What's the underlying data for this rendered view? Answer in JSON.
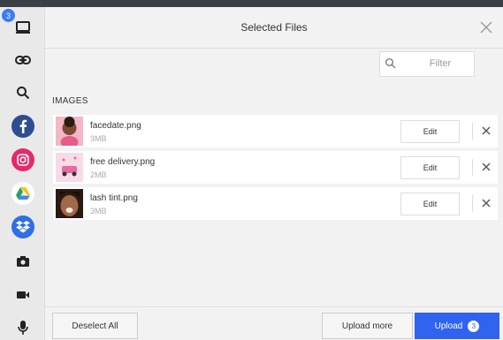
{
  "sidebar": {
    "local_badge": "3",
    "items": [
      {
        "name": "my-device",
        "icon": "monitor-icon"
      },
      {
        "name": "link",
        "icon": "link-icon"
      },
      {
        "name": "search",
        "icon": "search-icon"
      },
      {
        "name": "facebook",
        "icon": "facebook-icon",
        "color": "#2d4e8f"
      },
      {
        "name": "instagram",
        "icon": "instagram-icon",
        "color": "#e8286b"
      },
      {
        "name": "google-drive",
        "icon": "google-drive-icon",
        "color": "#ffffff"
      },
      {
        "name": "dropbox",
        "icon": "dropbox-icon",
        "color": "#2f6fe6"
      },
      {
        "name": "camera",
        "icon": "camera-icon"
      },
      {
        "name": "video",
        "icon": "video-icon"
      },
      {
        "name": "audio",
        "icon": "microphone-icon"
      }
    ]
  },
  "header": {
    "title": "Selected Files",
    "close_icon": "close-icon"
  },
  "filter": {
    "placeholder": "Filter",
    "icon": "search-icon"
  },
  "section_label": "IMAGES",
  "files": [
    {
      "name": "facedate.png",
      "size": "3MB",
      "edit_label": "Edit"
    },
    {
      "name": "free delivery.png",
      "size": "2MB",
      "edit_label": "Edit"
    },
    {
      "name": "lash tint.png",
      "size": "3MB",
      "edit_label": "Edit"
    }
  ],
  "footer": {
    "deselect_label": "Deselect All",
    "upload_more_label": "Upload more",
    "upload_label": "Upload",
    "upload_count": "3"
  },
  "colors": {
    "primary": "#2f63f0",
    "badge": "#3b7cf7",
    "topbar": "#3a3f48"
  }
}
